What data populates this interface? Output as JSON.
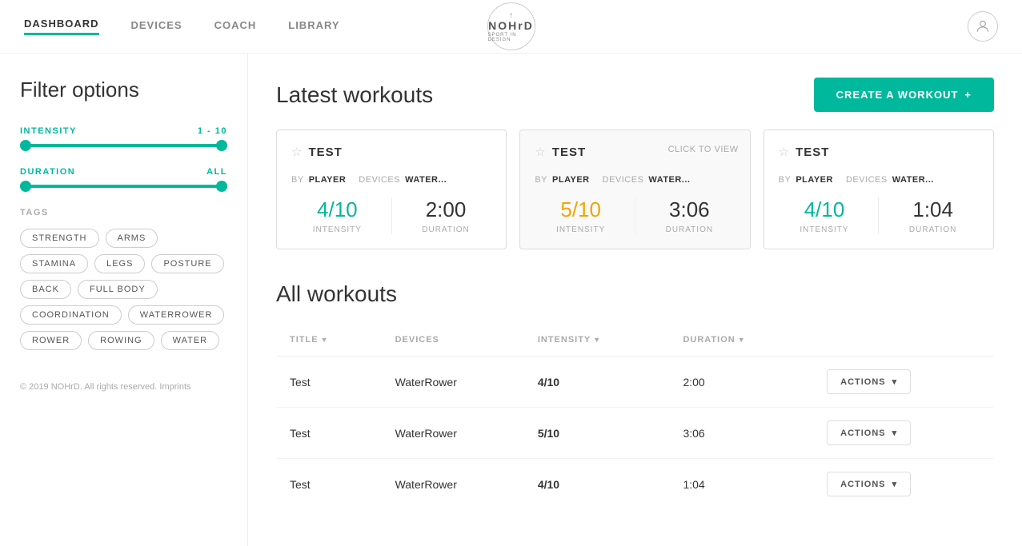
{
  "nav": {
    "links": [
      {
        "id": "dashboard",
        "label": "DASHBOARD",
        "active": true
      },
      {
        "id": "devices",
        "label": "DEVICES",
        "active": false
      },
      {
        "id": "coach",
        "label": "COACH",
        "active": false
      },
      {
        "id": "library",
        "label": "LIBRARY",
        "active": false
      }
    ],
    "logo": {
      "name": "NOHrD",
      "sub": "SPORT IN DESIGN",
      "arrow": "↑"
    }
  },
  "sidebar": {
    "title": "Filter options",
    "intensity": {
      "label": "INTENSITY",
      "value": "1 - 10"
    },
    "duration": {
      "label": "DURATION",
      "value": "ALL"
    },
    "tags": {
      "label": "TAGS",
      "items": [
        "STRENGTH",
        "ARMS",
        "STAMINA",
        "LEGS",
        "POSTURE",
        "BACK",
        "FULL BODY",
        "COORDINATION",
        "WATERROWER",
        "ROWER",
        "ROWING",
        "WATER"
      ]
    },
    "footer": "© 2019 NOHrD. All rights reserved. Imprints"
  },
  "main": {
    "latest_workouts": {
      "title": "Latest workouts",
      "create_button": "CREATE A WORKOUT",
      "cards": [
        {
          "id": "card1",
          "title": "TEST",
          "star": "☆",
          "by_label": "BY",
          "by_value": "PLAYER",
          "devices_label": "DEVICES",
          "devices_value": "WATER...",
          "intensity_value": "4/10",
          "intensity_color": "green",
          "duration_value": "2:00",
          "intensity_label": "INTENSITY",
          "duration_label": "DURATION",
          "highlighted": false,
          "click_to_view": ""
        },
        {
          "id": "card2",
          "title": "TEST",
          "star": "☆",
          "by_label": "BY",
          "by_value": "PLAYER",
          "devices_label": "DEVICES",
          "devices_value": "WATER...",
          "intensity_value": "5/10",
          "intensity_color": "orange",
          "duration_value": "3:06",
          "intensity_label": "INTENSITY",
          "duration_label": "DURATION",
          "highlighted": true,
          "click_to_view": "CLICK TO VIEW"
        },
        {
          "id": "card3",
          "title": "TEST",
          "star": "☆",
          "by_label": "BY",
          "by_value": "PLAYER",
          "devices_label": "DEVICES",
          "devices_value": "WATER...",
          "intensity_value": "4/10",
          "intensity_color": "green",
          "duration_value": "1:04",
          "intensity_label": "INTENSITY",
          "duration_label": "DURATION",
          "highlighted": false,
          "click_to_view": ""
        }
      ]
    },
    "all_workouts": {
      "title": "All workouts",
      "columns": [
        {
          "id": "title",
          "label": "TITLE",
          "sortable": true
        },
        {
          "id": "devices",
          "label": "DEVICES",
          "sortable": false
        },
        {
          "id": "intensity",
          "label": "INTENSITY",
          "sortable": true
        },
        {
          "id": "duration",
          "label": "DURATION",
          "sortable": true
        },
        {
          "id": "actions",
          "label": "",
          "sortable": false
        }
      ],
      "rows": [
        {
          "title": "Test",
          "devices": "WaterRower",
          "intensity": "4/10",
          "intensity_color": "green",
          "duration": "2:00",
          "actions": "ACTIONS"
        },
        {
          "title": "Test",
          "devices": "WaterRower",
          "intensity": "5/10",
          "intensity_color": "orange",
          "duration": "3:06",
          "actions": "ACTIONS"
        },
        {
          "title": "Test",
          "devices": "WaterRower",
          "intensity": "4/10",
          "intensity_color": "green",
          "duration": "1:04",
          "actions": "ACTIONS"
        }
      ]
    }
  }
}
